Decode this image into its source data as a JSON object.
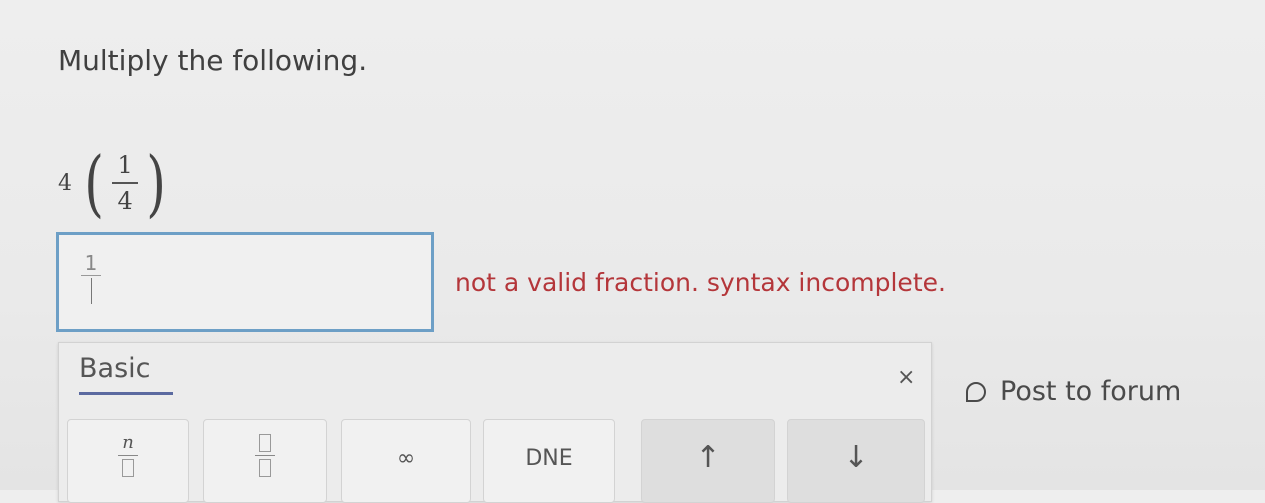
{
  "question": {
    "prompt": "Multiply the following.",
    "expression": {
      "coefficient": "4",
      "numerator": "1",
      "denominator": "4"
    }
  },
  "answer": {
    "numerator": "1",
    "denominator": ""
  },
  "feedback": {
    "message": "not a valid fraction. syntax incomplete."
  },
  "keypad": {
    "tab_label": "Basic",
    "close_label": "×",
    "keys": {
      "fraction_n_numerator": "n",
      "infinity": "∞",
      "dne": "DNE",
      "up": "↑",
      "down": "↓"
    }
  },
  "forum": {
    "label": "Post to forum"
  }
}
